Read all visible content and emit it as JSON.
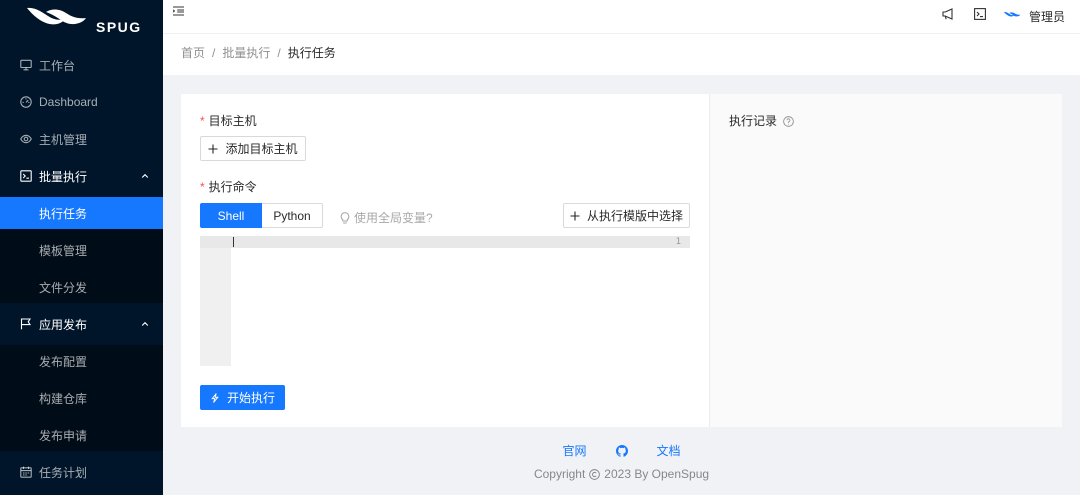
{
  "theme": {
    "accent": "#1677ff",
    "sidebar_bg": "#001529",
    "submenu_bg": "#000c17",
    "required": "#ff4d4f"
  },
  "logo": {
    "text": "SPUG",
    "icon": "spug-logo-icon"
  },
  "sidebar": {
    "items": [
      {
        "label": "工作台",
        "icon": "desktop-icon"
      },
      {
        "label": "Dashboard",
        "icon": "dashboard-icon"
      },
      {
        "label": "主机管理",
        "icon": "cloud-server-icon"
      },
      {
        "label": "批量执行",
        "icon": "code-square-icon",
        "expanded": true,
        "children": [
          {
            "label": "执行任务",
            "selected": true
          },
          {
            "label": "模板管理"
          },
          {
            "label": "文件分发"
          }
        ]
      },
      {
        "label": "应用发布",
        "icon": "flag-icon",
        "expanded": true,
        "children": [
          {
            "label": "发布配置"
          },
          {
            "label": "构建仓库"
          },
          {
            "label": "发布申请"
          }
        ]
      },
      {
        "label": "任务计划",
        "icon": "schedule-icon"
      }
    ]
  },
  "header": {
    "fold_icon": "menu-fold-icon",
    "notification_icon": "notification-icon",
    "terminal_icon": "terminal-icon",
    "avatar_icon": "spug-avatar-icon",
    "username": "管理员"
  },
  "breadcrumb": {
    "items": [
      "首页",
      "批量执行",
      "执行任务"
    ],
    "separator": "/"
  },
  "form": {
    "required_mark": "*",
    "target_label": "目标主机",
    "add_host_button": "添加目标主机",
    "command_label": "执行命令",
    "interpreters": [
      "Shell",
      "Python"
    ],
    "active_interpreter_index": 0,
    "global_vars_hint": "使用全局变量?",
    "template_button": "从执行模版中选择",
    "editor": {
      "line_numbers": [
        "1"
      ],
      "content": ""
    },
    "run_button": "开始执行"
  },
  "history": {
    "title": "执行记录",
    "help_icon": "question-circle-icon"
  },
  "footer": {
    "links": [
      "官网",
      "文档"
    ],
    "github_icon": "github-icon",
    "copyright_prefix": "Copyright",
    "copyright_icon": "copyright-icon",
    "copyright_suffix": "2023 By OpenSpug"
  }
}
